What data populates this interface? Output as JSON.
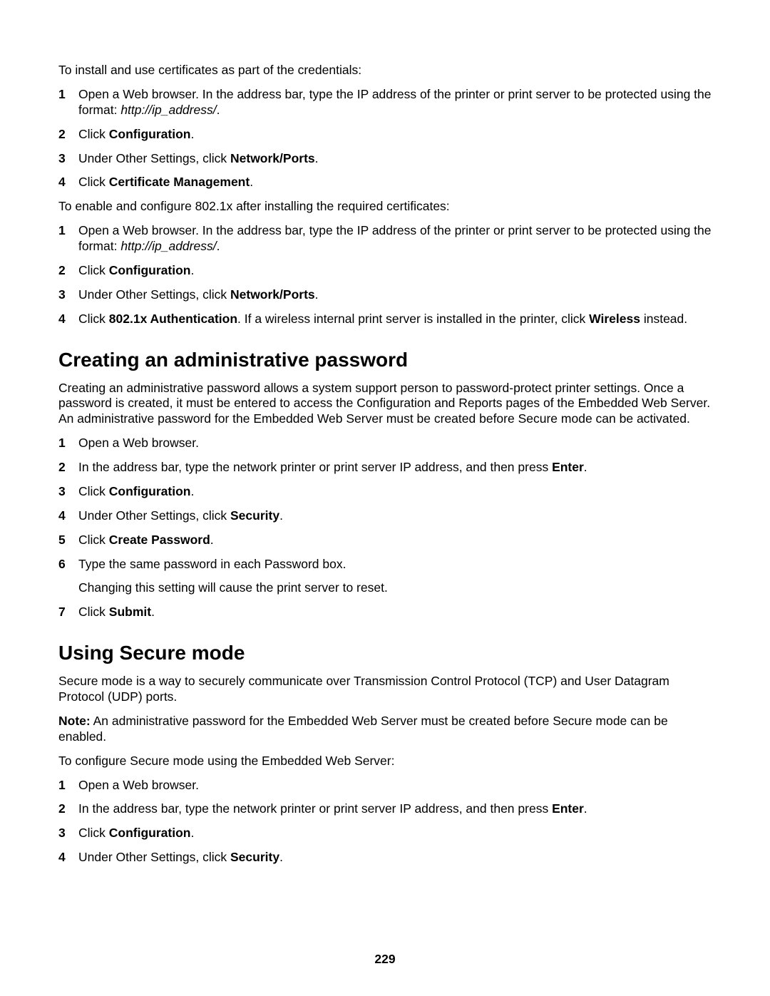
{
  "intro1": "To install and use certificates as part of the credentials:",
  "list1": {
    "1a": "Open a Web browser. In the address bar, type the IP address of the printer or print server to be protected using the format: ",
    "1b_ital": "http://ip_address/",
    "1c": ".",
    "2a": "Click ",
    "2b_bold": "Configuration",
    "2c": ".",
    "3a": "Under Other Settings, click ",
    "3b_bold": "Network/Ports",
    "3c": ".",
    "4a": "Click ",
    "4b_bold": "Certificate Management",
    "4c": "."
  },
  "intro2": "To enable and configure 802.1x after installing the required certificates:",
  "list2": {
    "1a": "Open a Web browser. In the address bar, type the IP address of the printer or print server to be protected using the format: ",
    "1b_ital": "http://ip_address/",
    "1c": ".",
    "2a": "Click ",
    "2b_bold": "Configuration",
    "2c": ".",
    "3a": "Under Other Settings, click ",
    "3b_bold": "Network/Ports",
    "3c": ".",
    "4a": "Click ",
    "4b_bold": "802.1x Authentication",
    "4c": ". If a wireless internal print server is installed in the printer, click ",
    "4d_bold": "Wireless",
    "4e": " instead."
  },
  "h1": "Creating an administrative password",
  "para1": "Creating an administrative password allows a system support person to password-protect printer settings. Once a password is created, it must be entered to access the Configuration and Reports pages of the Embedded Web Server. An administrative password for the Embedded Web Server must be created before Secure mode can be activated.",
  "list3": {
    "1": "Open a Web browser.",
    "2a": "In the address bar, type the network printer or print server IP address, and then press ",
    "2b_bold": "Enter",
    "2c": ".",
    "3a": "Click ",
    "3b_bold": "Configuration",
    "3c": ".",
    "4a": "Under Other Settings, click ",
    "4b_bold": "Security",
    "4c": ".",
    "5a": "Click ",
    "5b_bold": "Create Password",
    "5c": ".",
    "6": "Type the same password in each Password box.",
    "6x": "Changing this setting will cause the print server to reset.",
    "7a": "Click ",
    "7b_bold": "Submit",
    "7c": "."
  },
  "h2": "Using Secure mode",
  "para2": "Secure mode is a way to securely communicate over Transmission Control Protocol (TCP) and User Datagram Protocol (UDP) ports.",
  "note_label": "Note:",
  "note_text": " An administrative password for the Embedded Web Server must be created before Secure mode can be enabled.",
  "para3": "To configure Secure mode using the Embedded Web Server:",
  "list4": {
    "1": "Open a Web browser.",
    "2a": "In the address bar, type the network printer or print server IP address, and then press ",
    "2b_bold": "Enter",
    "2c": ".",
    "3a": "Click ",
    "3b_bold": "Configuration",
    "3c": ".",
    "4a": "Under Other Settings, click ",
    "4b_bold": "Security",
    "4c": "."
  },
  "page_number": "229",
  "nums": {
    "n1": "1",
    "n2": "2",
    "n3": "3",
    "n4": "4",
    "n5": "5",
    "n6": "6",
    "n7": "7"
  }
}
